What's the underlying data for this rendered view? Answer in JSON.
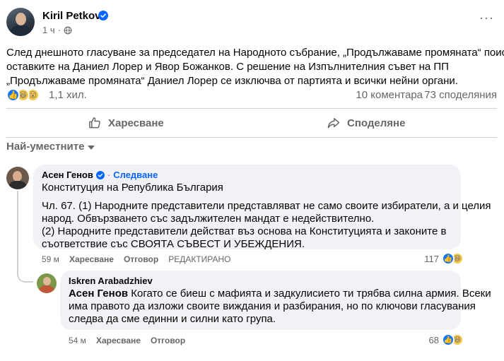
{
  "post": {
    "author": "Kiril Petkov",
    "time": "1 ч",
    "more": "···",
    "text_lines": [
      "След днешното гласуване за председател на Народното събрание, „Продължаваме промяната“ поиска",
      "оставките на Даниел Лорер и Явор Божанков. С решение на Изпълнителния съвет на ПП",
      "„Продължаваме промяната“ Даниел Лорер се изключва от партията и всички нейни органи."
    ]
  },
  "stats": {
    "reactions": "1,1 хил.",
    "comments": "10 коментара",
    "shares": "73 споделяния"
  },
  "actions": {
    "like": "Харесване",
    "share": "Споделяне"
  },
  "sort": {
    "label": "Най-уместните"
  },
  "comments": [
    {
      "author": "Асен Генов",
      "dot": "·",
      "follow": "Следване",
      "body": [
        "Конституция на Република България",
        "Чл. 67. (1) Народните представители представляват не само своите избиратели, а и целия",
        "народ. Обвързването със задължителен мандат е недействително.",
        "(2) Народните представители действат въз основа на Конституцията и законите в",
        "съответствие със СВОЯТА СЪВЕСТ И УБЕЖДЕНИЯ."
      ],
      "time": "59 м",
      "like": "Харесване",
      "reply": "Отговор",
      "edited": "РЕДАКТИРАНО",
      "reactions": "117"
    },
    {
      "author": "Iskren Arabadzhiev",
      "mention": "Асен Генов",
      "body": [
        " Когато се биеш с мафията и задкулисието ти трябва силна армия. Всеки",
        "има правото да изложи своите виждания и разбирания, но по ключови гласувания",
        "следва да сме единни и силни като група."
      ],
      "time": "54 м",
      "like": "Харесване",
      "reply": "Отговор",
      "reactions": "68"
    }
  ],
  "colors": {
    "accent": "#0866ff",
    "like": "#1877f2",
    "secondary_text": "#65676b",
    "bubble": "#f0f2f5"
  }
}
